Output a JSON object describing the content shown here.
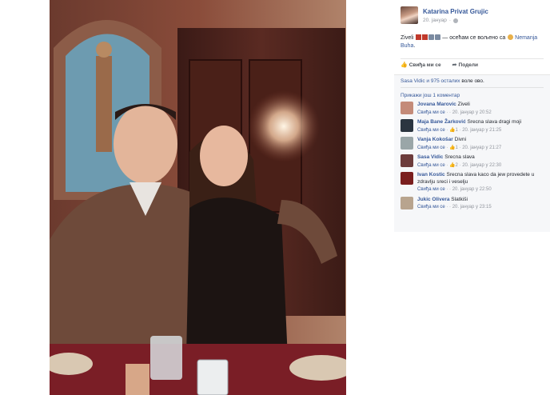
{
  "post": {
    "author": "Katarina Privat Grujic",
    "date": "20. јануар",
    "text_before": "Ziveli",
    "text_mid": "— осећам се вољено са",
    "tagged": "Nemanja Buha",
    "text_after": "."
  },
  "actions": {
    "like": "Свиђа ми се",
    "share": "Подели"
  },
  "likes": {
    "names": "Sasa Vidic",
    "rest": "и 975 осталих",
    "suffix": "воле ово."
  },
  "previous_comments": "Прикажи још 1 коментар",
  "comments": [
    {
      "name": "Jovana Marovic",
      "text": "Ziveli",
      "like": "Свиђа ми се",
      "count": "",
      "date": "20. јануар у 20:52",
      "avatar_color": "#c48b79"
    },
    {
      "name": "Maja Bane Žarković",
      "text": "Srecna slava dragi moji",
      "like": "Свиђа ми се",
      "count": "1",
      "date": "20. јануар у 21:25",
      "avatar_color": "#2b3540"
    },
    {
      "name": "Vanja Kokošar",
      "text": "Divni",
      "like": "Свиђа ми се",
      "count": "1",
      "date": "20. јануар у 21:27",
      "avatar_color": "#9aa6a8"
    },
    {
      "name": "Sasa Vidic",
      "text": "Srecna slava",
      "like": "Свиђа ми се",
      "count": "2",
      "date": "20. јануар у 22:30",
      "avatar_color": "#6c3b3b"
    },
    {
      "name": "Ivan Kostic",
      "text": "Srecna slava kaco da jew provedete u zdravlju sreci i veselju",
      "like": "Свиђа ми се",
      "count": "",
      "date": "20. јануар у 22:50",
      "avatar_color": "#7a1e1e"
    },
    {
      "name": "Jukic Olivera",
      "text": "Slatkiši",
      "like": "Свиђа ми се",
      "count": "",
      "date": "20. јануар у 23:15",
      "avatar_color": "#b8a48e"
    }
  ],
  "colors": {
    "link": "#365899",
    "meta": "#90949c",
    "panel_bg": "#f6f7f9"
  }
}
